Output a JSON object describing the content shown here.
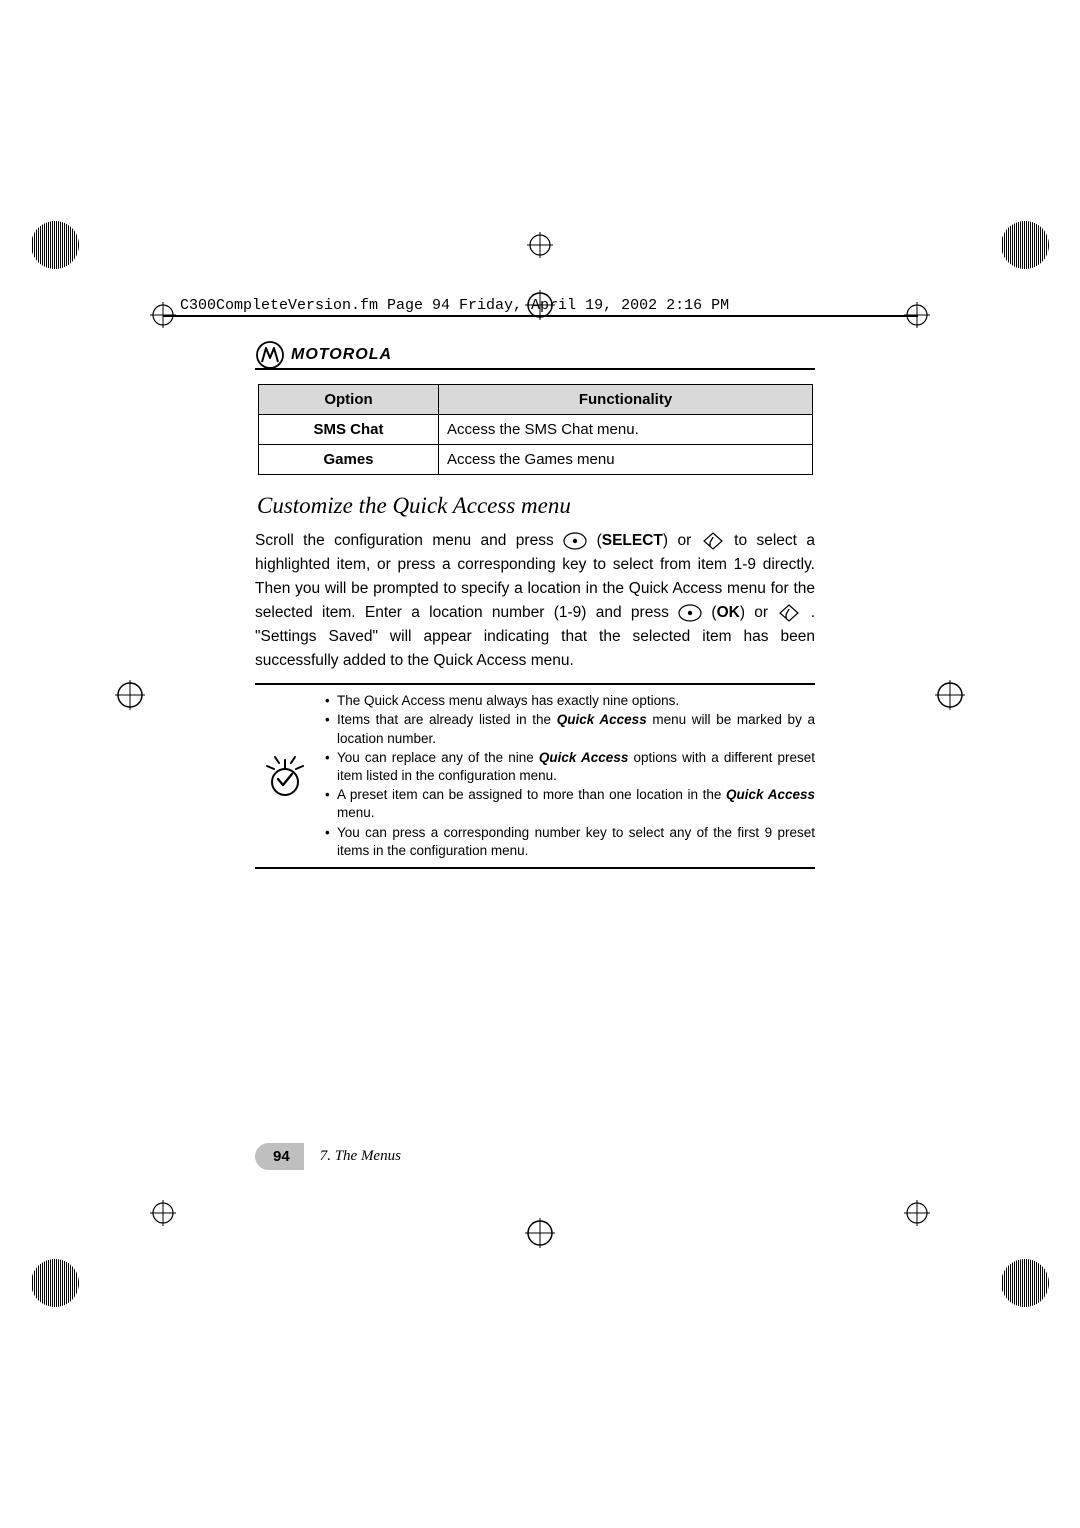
{
  "header_meta": "C300CompleteVersion.fm  Page 94  Friday, April 19, 2002  2:16 PM",
  "brand": "MOTOROLA",
  "table": {
    "headers": {
      "option": "Option",
      "functionality": "Functionality"
    },
    "rows": [
      {
        "option": "SMS Chat",
        "functionality": "Access the SMS Chat menu."
      },
      {
        "option": "Games",
        "functionality": "Access the Games menu"
      }
    ]
  },
  "section_title": "Customize the Quick Access menu",
  "para1": {
    "t1": " Scroll the configuration menu and press ",
    "select_label": "SELECT",
    "t2": ") or ",
    "t3": " to select a highlighted item, or press a corresponding key to select from item 1-9 directly. Then you will be prompted to specify a location in the Quick Access menu for the selected item. Enter a location number (1-9) and press ",
    "ok_label": "OK",
    "t4": ") or ",
    "t5": ". \"Settings Saved\" will appear indicating that the selected item has been successfully added to the Quick Access menu."
  },
  "notes": {
    "n1": "The Quick Access menu always has exactly nine options.",
    "n2a": "Items that are already listed in the ",
    "qa": "Quick Access",
    "n2b": " menu will be marked by a location number.",
    "n3a": "You can replace any of the nine ",
    "n3b": " options with a different preset item listed in the configuration menu.",
    "n4a": "A preset item can be assigned to more than one location in the ",
    "n4b": " menu.",
    "n5": "You can press a corresponding number key to select any of the first 9 preset items in the configuration menu."
  },
  "footer": {
    "page": "94",
    "chapter": "7. The Menus"
  }
}
